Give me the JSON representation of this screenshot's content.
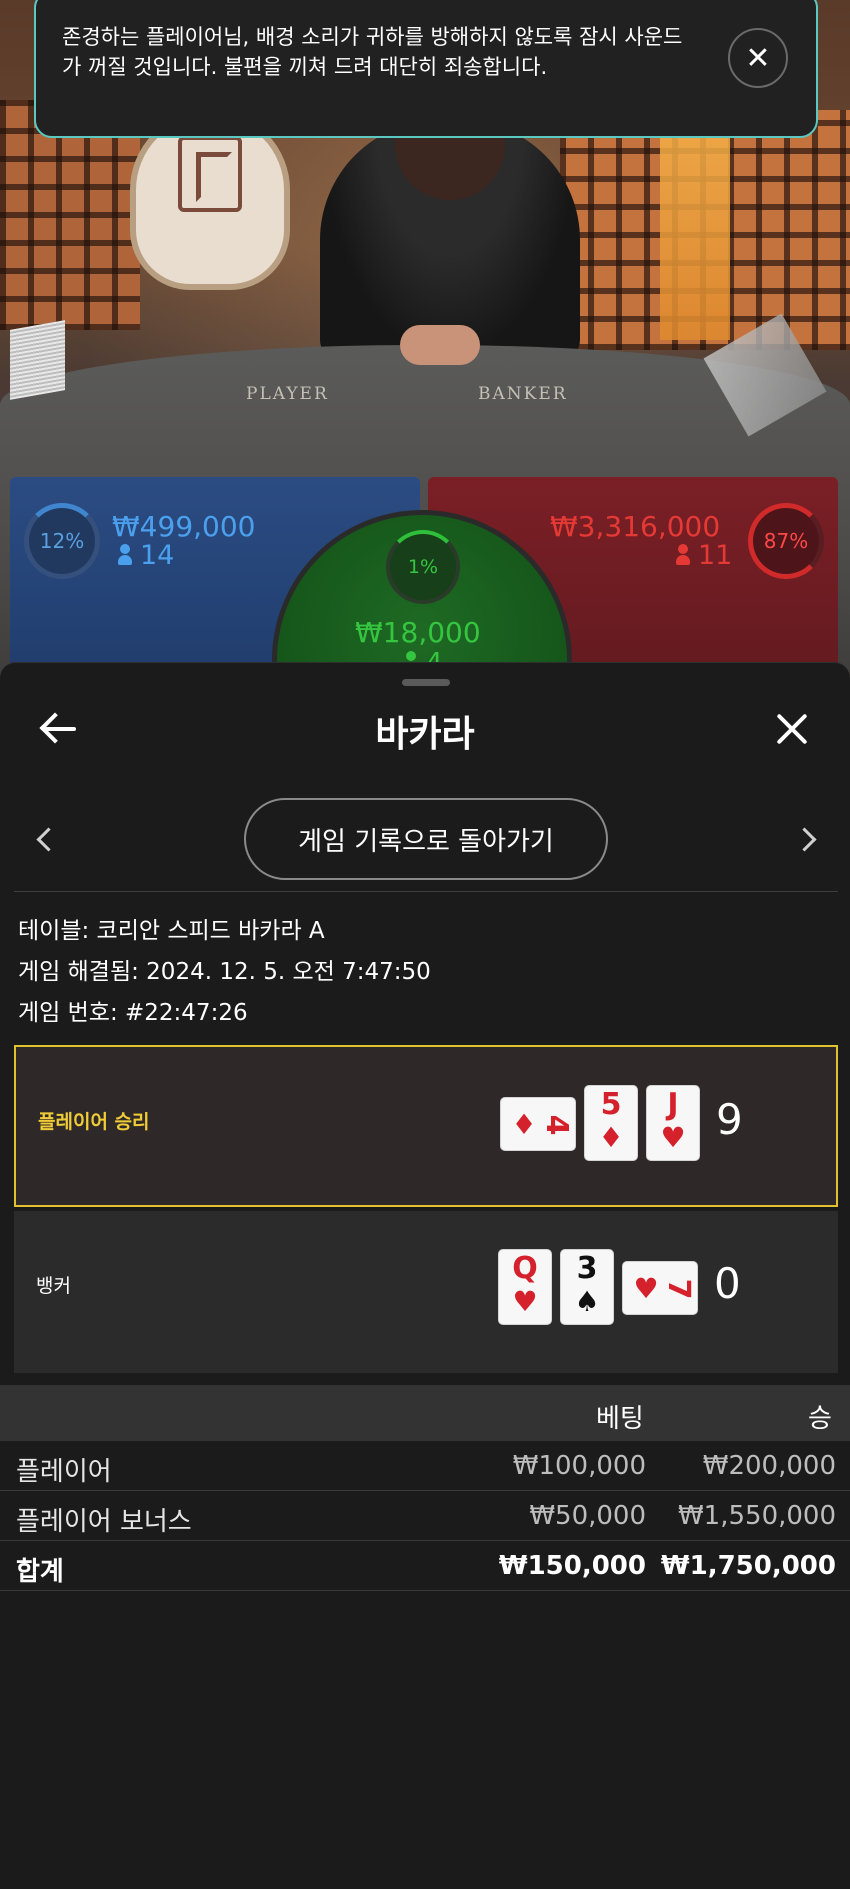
{
  "notification": {
    "message": "존경하는 플레이어님, 배경 소리가 귀하를 방해하지 않도록 잠시 사운드가 꺼질 것입니다. 불편을 끼쳐 드려 대단히 죄송합니다.",
    "close_icon": "close-icon"
  },
  "table_felt": {
    "player_label": "PLAYER",
    "banker_label": "BANKER"
  },
  "bets": {
    "player": {
      "percent": "12%",
      "amount": "₩499,000",
      "players": "14",
      "color": "#4ba0ee"
    },
    "tie": {
      "percent": "1%",
      "amount": "₩18,000",
      "players": "4",
      "color": "#35c540"
    },
    "banker": {
      "percent": "87%",
      "amount": "₩3,316,000",
      "players": "11",
      "color": "#e53935"
    }
  },
  "sheet": {
    "title": "바카라",
    "back_icon": "arrow-left-icon",
    "close_icon": "close-icon",
    "history_button": "게임 기록으로 돌아가기",
    "prev_icon": "chevron-left-icon",
    "next_icon": "chevron-right-icon"
  },
  "game_info": {
    "table": "테이블: 코리안 스피드 바카라 A",
    "resolved": "게임 해결됨: 2024. 12. 5. 오전 7:47:50",
    "number": "게임 번호: #22:47:26"
  },
  "results": {
    "player": {
      "label": "플레이어 승리",
      "score": "9",
      "highlight_color": "#e0c22e",
      "cards": [
        {
          "rank": "4",
          "suit": "♦",
          "color": "red",
          "orientation": "horizontal"
        },
        {
          "rank": "5",
          "suit": "♦",
          "color": "red",
          "orientation": "vertical"
        },
        {
          "rank": "J",
          "suit": "♥",
          "color": "red",
          "orientation": "vertical"
        }
      ]
    },
    "banker": {
      "label": "뱅커",
      "score": "0",
      "cards": [
        {
          "rank": "Q",
          "suit": "♥",
          "color": "red",
          "orientation": "vertical"
        },
        {
          "rank": "3",
          "suit": "♠",
          "color": "black",
          "orientation": "vertical"
        },
        {
          "rank": "7",
          "suit": "♥",
          "color": "red",
          "orientation": "horizontal"
        }
      ]
    }
  },
  "bet_table": {
    "headers": {
      "bet": "베팅",
      "win": "승"
    },
    "rows": [
      {
        "name": "플레이어",
        "bet": "₩100,000",
        "win": "₩200,000"
      },
      {
        "name": "플레이어 보너스",
        "bet": "₩50,000",
        "win": "₩1,550,000"
      }
    ],
    "total": {
      "name": "합계",
      "bet": "₩150,000",
      "win": "₩1,750,000"
    }
  }
}
